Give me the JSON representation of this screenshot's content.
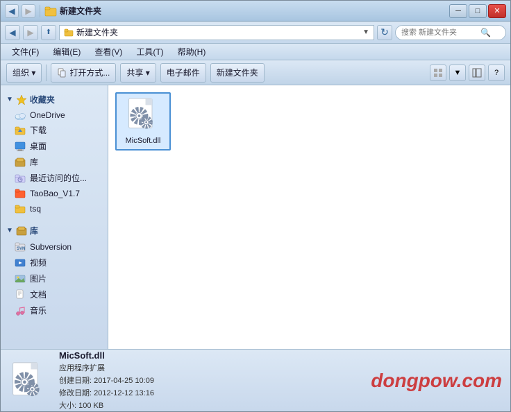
{
  "window": {
    "title": "新建文件夹",
    "controls": {
      "minimize": "─",
      "maximize": "□",
      "close": "✕"
    }
  },
  "addressbar": {
    "path": "新建文件夹",
    "search_placeholder": "搜索 新建文件夹"
  },
  "menubar": {
    "items": [
      "文件(F)",
      "编辑(E)",
      "查看(V)",
      "工具(T)",
      "帮助(H)"
    ]
  },
  "toolbar": {
    "organize": "组织 ▾",
    "open_with": "打开方式...",
    "share": "共享 ▾",
    "email": "电子邮件",
    "new_folder": "新建文件夹",
    "view_icon": "⊞",
    "help_icon": "?"
  },
  "sidebar": {
    "favorites_label": "收藏夹",
    "favorites_items": [
      {
        "label": "OneDrive",
        "icon": "onedrive"
      },
      {
        "label": "下载",
        "icon": "download"
      },
      {
        "label": "桌面",
        "icon": "desktop"
      },
      {
        "label": "库",
        "icon": "library"
      },
      {
        "label": "最近访问的位...",
        "icon": "recent"
      },
      {
        "label": "TaoBao_V1.7",
        "icon": "taobao"
      },
      {
        "label": "tsq",
        "icon": "folder"
      }
    ],
    "library_label": "库",
    "library_items": [
      {
        "label": "Subversion",
        "icon": "subversion"
      },
      {
        "label": "视频",
        "icon": "video"
      },
      {
        "label": "图片",
        "icon": "picture"
      },
      {
        "label": "文档",
        "icon": "document"
      },
      {
        "label": "音乐",
        "icon": "music"
      }
    ]
  },
  "files": [
    {
      "name": "MicSoft.dll",
      "type": "dll"
    }
  ],
  "statusbar": {
    "filename": "MicSoft.dll",
    "type": "应用程序扩展",
    "created": "创建日期: 2017-04-25 10:09",
    "modified": "修改日期: 2012-12-12 13:16",
    "size": "大小: 100 KB",
    "watermark": "dongpow.com"
  },
  "colors": {
    "accent": "#4a90d4",
    "sidebar_bg": "#dce8f5",
    "window_border": "#7a8a99",
    "watermark": "#cc2222"
  }
}
